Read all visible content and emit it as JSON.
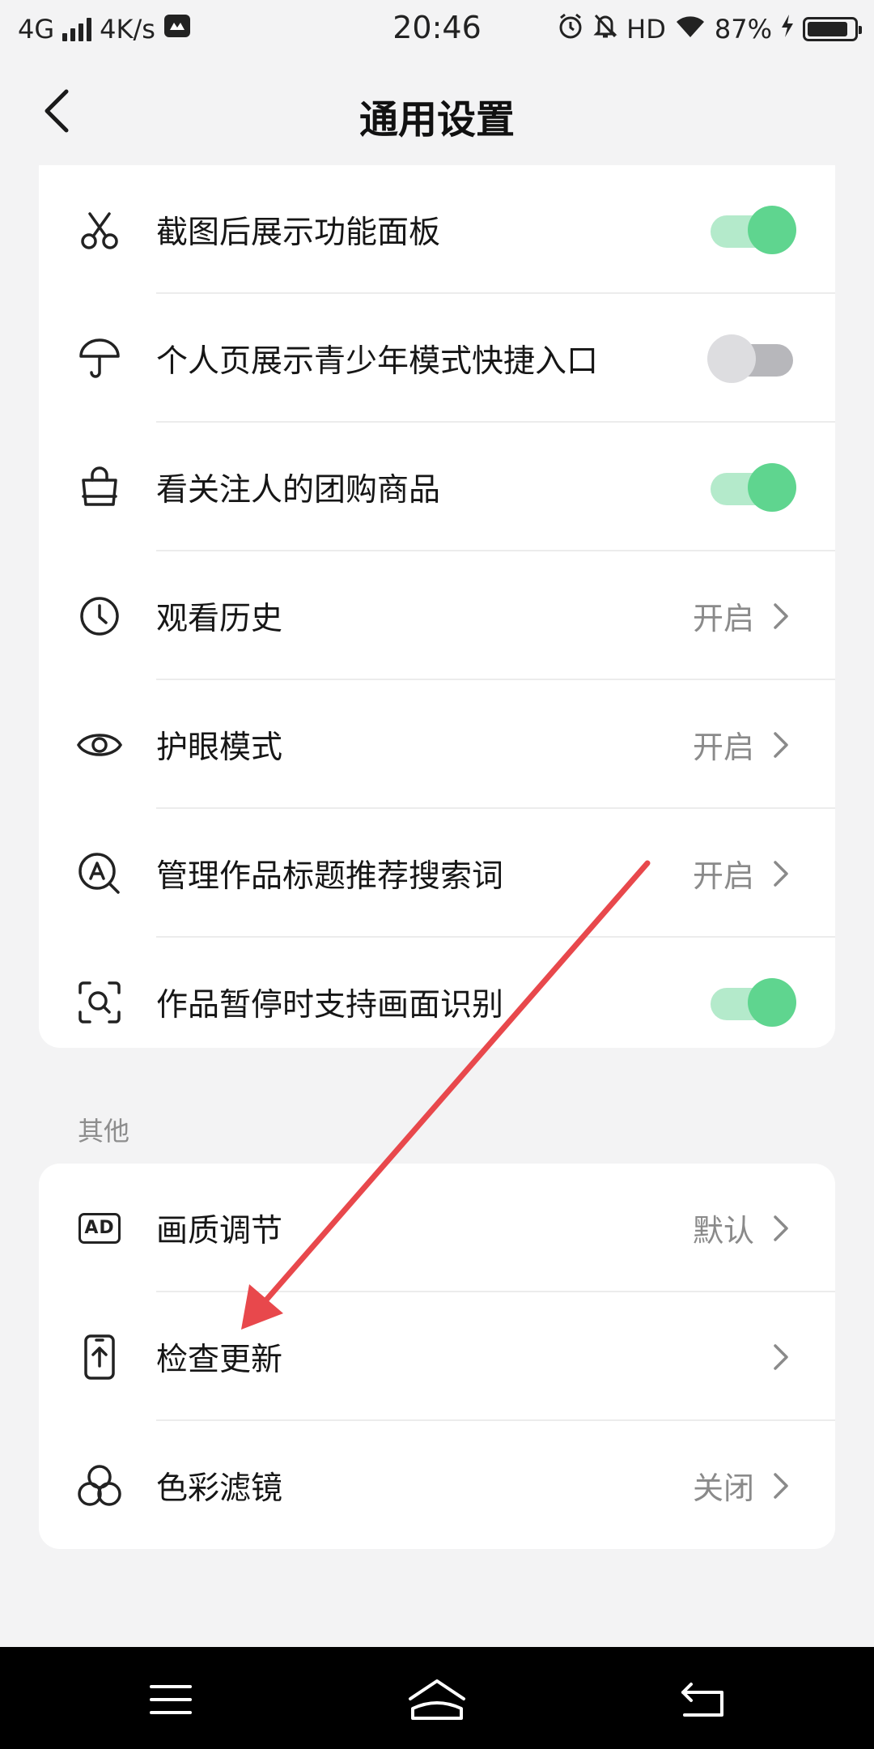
{
  "status_bar": {
    "network": "4G",
    "speed": "4K/s",
    "time": "20:46",
    "hd": "HD",
    "battery": "87%",
    "battery_level": 0.87
  },
  "header": {
    "title": "通用设置"
  },
  "section1": {
    "items": [
      {
        "label": "截图后展示功能面板",
        "icon": "scissors-icon",
        "control": "toggle",
        "on": true
      },
      {
        "label": "个人页展示青少年模式快捷入口",
        "icon": "umbrella-icon",
        "control": "toggle",
        "on": false
      },
      {
        "label": "看关注人的团购商品",
        "icon": "shopping-bag-icon",
        "control": "toggle",
        "on": true
      },
      {
        "label": "观看历史",
        "icon": "clock-icon",
        "control": "link",
        "value": "开启"
      },
      {
        "label": "护眼模式",
        "icon": "eye-icon",
        "control": "link",
        "value": "开启"
      },
      {
        "label": "管理作品标题推荐搜索词",
        "icon": "search-a-icon",
        "control": "link",
        "value": "开启"
      },
      {
        "label": "作品暂停时支持画面识别",
        "icon": "scan-search-icon",
        "control": "toggle",
        "on": true
      }
    ]
  },
  "section2": {
    "label": "其他",
    "items": [
      {
        "label": "画质调节",
        "icon": "ad-icon",
        "icon_text": "AD",
        "control": "link",
        "value": "默认"
      },
      {
        "label": "检查更新",
        "icon": "phone-update-icon",
        "control": "link",
        "value": ""
      },
      {
        "label": "色彩滤镜",
        "icon": "color-filter-icon",
        "control": "link",
        "value": "关闭"
      }
    ]
  },
  "colors": {
    "toggle_on_knob": "#5fd58f",
    "toggle_on_track": "#b4eacb",
    "toggle_off_knob": "#dddde0",
    "toggle_off_track": "#b7b7bb",
    "annotation_arrow": "#e8484c"
  }
}
